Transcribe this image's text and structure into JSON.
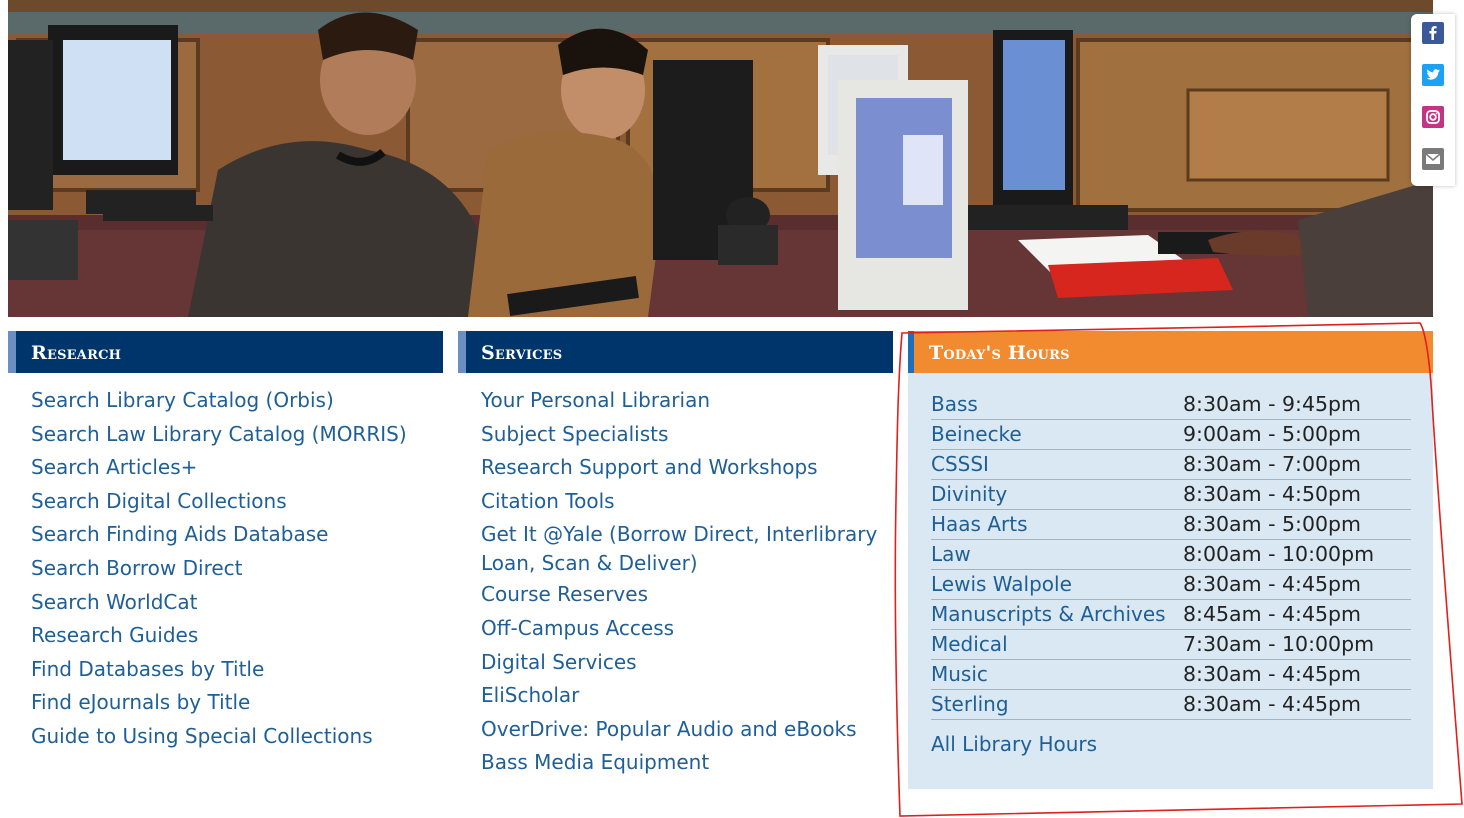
{
  "social": {
    "icons": [
      "facebook-icon",
      "twitter-icon",
      "instagram-icon",
      "email-icon"
    ],
    "colors": {
      "facebook": "#3b5998",
      "twitter": "#1da1f2",
      "instagram": "#c13584",
      "email": "#7a7a7a"
    }
  },
  "research": {
    "title": "Research",
    "links": [
      "Search Library Catalog (Orbis)",
      "Search Law Library Catalog (MORRIS)",
      "Search Articles+",
      "Search Digital Collections",
      "Search Finding Aids Database",
      "Search Borrow Direct",
      "Search WorldCat",
      "Research Guides",
      "Find Databases by Title",
      "Find eJournals by Title",
      "Guide to Using Special Collections"
    ]
  },
  "services": {
    "title": "Services",
    "links": [
      "Your Personal Librarian",
      "Subject Specialists",
      "Research Support and Workshops",
      "Citation Tools",
      "Get It @Yale (Borrow Direct, Interlibrary Loan, Scan & Deliver)",
      "Course Reserves",
      "Off-Campus Access",
      "Digital Services",
      "EliScholar",
      "OverDrive: Popular Audio and eBooks",
      "Bass Media Equipment"
    ]
  },
  "hours": {
    "title": "Today's Hours",
    "rows": [
      {
        "location": "Bass",
        "time": "8:30am - 9:45pm"
      },
      {
        "location": "Beinecke",
        "time": "9:00am - 5:00pm"
      },
      {
        "location": "CSSSI",
        "time": "8:30am - 7:00pm"
      },
      {
        "location": "Divinity",
        "time": "8:30am - 4:50pm"
      },
      {
        "location": "Haas Arts",
        "time": "8:30am - 5:00pm"
      },
      {
        "location": "Law",
        "time": "8:00am - 10:00pm"
      },
      {
        "location": "Lewis Walpole",
        "time": "8:30am - 4:45pm"
      },
      {
        "location": "Manuscripts & Archives",
        "time": "8:45am - 4:45pm"
      },
      {
        "location": "Medical",
        "time": "7:30am - 10:00pm"
      },
      {
        "location": "Music",
        "time": "8:30am - 4:45pm"
      },
      {
        "location": "Sterling",
        "time": "8:30am - 4:45pm"
      }
    ],
    "all_link": "All Library Hours"
  },
  "colors": {
    "header_blue": "#00356b",
    "header_orange": "#f28a30",
    "link_blue": "#1f5f97",
    "hours_panel_bg": "#d9e8f2",
    "annotation_red": "#e0201c"
  }
}
